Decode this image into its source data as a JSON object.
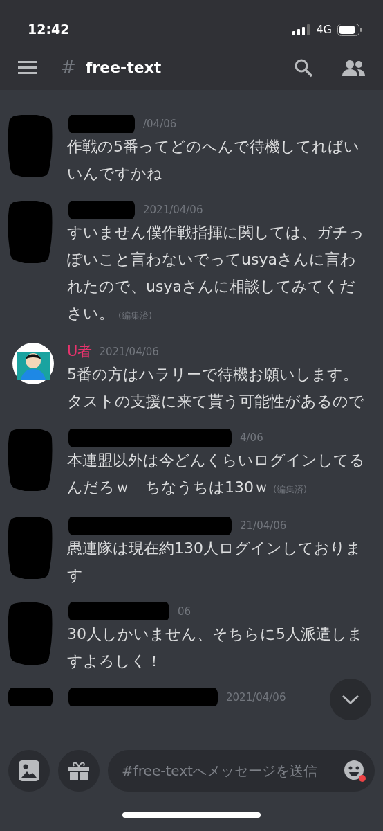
{
  "status_bar": {
    "time": "12:42",
    "network": "4G"
  },
  "header": {
    "channel_hash": "#",
    "channel": "free-text"
  },
  "messages": [
    {
      "redacted": true,
      "timestamp": "/04/06",
      "lines": "作戦の5番ってどのへんで待機してればいいんですかね"
    },
    {
      "redacted": true,
      "timestamp": "2021/04/06",
      "lines": "すいません僕作戦指揮に関しては、ガチっぽいこと言わないでってusyaさんに言われたので、usyaさんに相談してみてください。",
      "edited_label": "(編集済)"
    },
    {
      "redacted": false,
      "author": "U者",
      "color": "#e8336d",
      "timestamp": "2021/04/06",
      "lines": "5番の方はハラリーで待機お願いします。タストの支援に来て貰う可能性があるので"
    },
    {
      "redacted": true,
      "timestamp": "4/06",
      "lines": "本連盟以外は今どんくらいログインしてるんだろｗ　ちなうちは130ｗ",
      "edited_label": "(編集済)"
    },
    {
      "redacted": true,
      "timestamp": "21/04/06",
      "lines": "愚連隊は現在約130人ログインしております"
    },
    {
      "redacted": true,
      "timestamp": "06",
      "lines": "30人しかいません、そちらに5人派遣しますよろしく！"
    },
    {
      "redacted": true,
      "timestamp": "2021/04/06"
    }
  ],
  "composer": {
    "placeholder": "#free-textへメッセージを送信",
    "emoji_notification": true
  }
}
